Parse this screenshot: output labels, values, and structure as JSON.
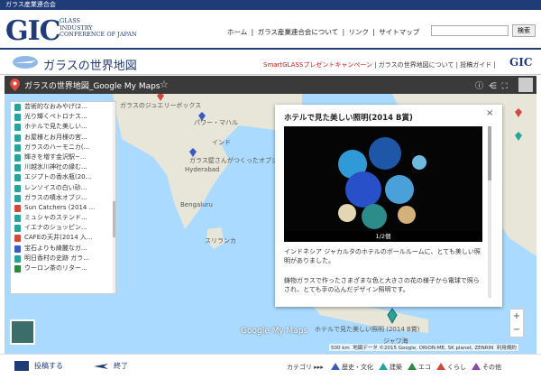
{
  "topbar": {
    "label": "ガラス産業連合会"
  },
  "header": {
    "logo": "GIC",
    "logo_sub": [
      "GLASS",
      "INDUSTRY",
      "CONFERENCE OF JAPAN"
    ],
    "nav": [
      "ホーム",
      "ガラス産業連合会について",
      "リンク",
      "サイトマップ"
    ],
    "search_button": "検索"
  },
  "subheader": {
    "title": "ガラスの世界地図",
    "links": [
      "SmartGLASSプレゼントキャンペーン",
      "ガラスの世界地図について",
      "投稿ガイド"
    ],
    "logo": "GIC"
  },
  "map": {
    "title": "ガラスの世界地図_Google My Maps",
    "star": "☆",
    "labels": {
      "jewelry": "ガラスのジュエリーボックス",
      "power": "パワー・マハル",
      "india": "インド",
      "objet": "ガラス壁さんがつくったオブジェ",
      "hyderabad": "Hyderabad",
      "bengaluru": "Bengaluru",
      "srilanka": "スリランカ",
      "javasea": "ジャワ海",
      "lighting": "ホテルで見た美しい照明 (2014 B賞)"
    },
    "google": "Google My Maps",
    "attribution": "地図データ ©2015 Google, ORION-ME, SK planet, ZENRIN",
    "scale": "500 km",
    "terms": "利用規約",
    "list": [
      {
        "label": "芸術的なおみやげ(2...",
        "color": "#2aa39a"
      },
      {
        "label": "光り輝くペトロナス...",
        "color": "#2aa39a"
      },
      {
        "label": "ホテルで見た美しい...",
        "color": "#2aa39a"
      },
      {
        "label": "お屋様とお月様の宮...",
        "color": "#2aa39a"
      },
      {
        "label": "ガラスのハーモニカ(...",
        "color": "#2aa39a"
      },
      {
        "label": "輝きを増す金沢駅~...",
        "color": "#2aa39a"
      },
      {
        "label": "川越氷川神社の縁む...",
        "color": "#2aa39a"
      },
      {
        "label": "エジプトの香水瓶(20...",
        "color": "#2aa39a"
      },
      {
        "label": "レンソイスの白い砂...",
        "color": "#2aa39a"
      },
      {
        "label": "ガラスの噴水オブジ...",
        "color": "#2aa39a"
      },
      {
        "label": "Sun Catchers (2014 ...",
        "color": "#d24a3c"
      },
      {
        "label": "ミュシャのステンド...",
        "color": "#2aa39a"
      },
      {
        "label": "イエナのショッピン...",
        "color": "#2aa39a"
      },
      {
        "label": "CAFEの天井(2014 入...",
        "color": "#d24a3c"
      },
      {
        "label": "宝石よりも綺麗なガ...",
        "color": "#3b5cbf"
      },
      {
        "label": "明日香村の史跡 ガラ...",
        "color": "#2aa39a"
      },
      {
        "label": "ウーロン茶のリター...",
        "color": "#2d8a3d"
      }
    ]
  },
  "popup": {
    "title": "ホテルで見た美しい照明(2014 B賞)",
    "close": "×",
    "counter": "1/2個",
    "desc": "インドネシア ジャカルタのホテルのボールルームに、とても美しい照明がありました。",
    "desc2": "鋳物ガラスで作ったさまざまな色と大きさの花の様子から電球で照らされ、とても手の込んだデザイン照明です。"
  },
  "zoom": {
    "in": "+",
    "out": "−"
  },
  "footer": {
    "post": "投稿する",
    "end": "終了",
    "categories_label": "カテゴリ ▸▸▸",
    "categories": [
      {
        "label": "歴史・文化",
        "color": "#3b5cbf"
      },
      {
        "label": "建築",
        "color": "#2aa39a"
      },
      {
        "label": "エコ",
        "color": "#2d8a3d"
      },
      {
        "label": "くらし",
        "color": "#d24a3c"
      },
      {
        "label": "その他",
        "color": "#8e4aa8"
      }
    ]
  }
}
